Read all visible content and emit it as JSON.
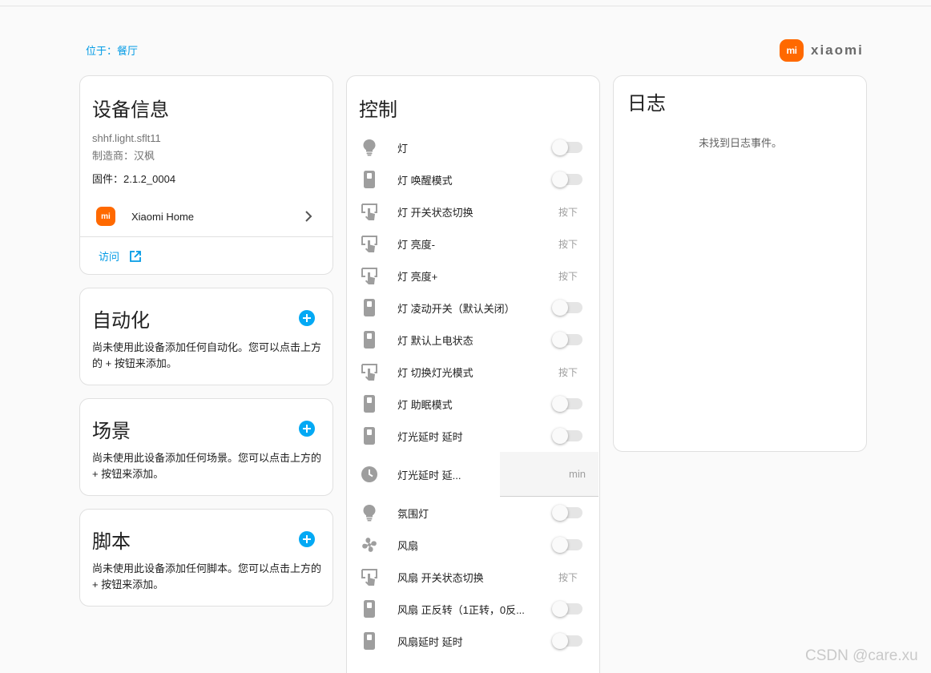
{
  "location": "位于：餐厅",
  "brand": {
    "logo_text": "mi",
    "name": "xiaomi",
    "color": "#ff6900"
  },
  "device_info": {
    "title": "设备信息",
    "model": "shhf.light.sflt11",
    "manufacturer": "制造商：汉枫",
    "firmware": "固件：2.1.2_0004",
    "integration": {
      "logo_text": "mi",
      "name": "Xiaomi Home",
      "icon": "chevron-right-icon"
    },
    "visit_label": "访问",
    "visit_icon": "external-link-icon"
  },
  "automation": {
    "title": "自动化",
    "description": "尚未使用此设备添加任何自动化。您可以点击上方的 + 按钮来添加。"
  },
  "scene": {
    "title": "场景",
    "description": "尚未使用此设备添加任何场景。您可以点击上方的 + 按钮来添加。"
  },
  "script": {
    "title": "脚本",
    "description": "尚未使用此设备添加任何脚本。您可以点击上方的 + 按钮来添加。"
  },
  "controls": {
    "title": "控制",
    "press_label": "按下",
    "items": [
      {
        "label": "灯",
        "icon": "lightbulb-icon",
        "type": "toggle"
      },
      {
        "label": "灯 唤醒模式",
        "icon": "switch-icon",
        "type": "toggle"
      },
      {
        "label": "灯 开关状态切换",
        "icon": "button-press-icon",
        "type": "press"
      },
      {
        "label": "灯 亮度-",
        "icon": "button-press-icon",
        "type": "press"
      },
      {
        "label": "灯 亮度+",
        "icon": "button-press-icon",
        "type": "press"
      },
      {
        "label": "灯 凌动开关（默认关闭）",
        "icon": "switch-icon",
        "type": "toggle"
      },
      {
        "label": "灯 默认上电状态",
        "icon": "switch-icon",
        "type": "toggle"
      },
      {
        "label": "灯 切换灯光模式",
        "icon": "button-press-icon",
        "type": "press"
      },
      {
        "label": "灯 助眠模式",
        "icon": "switch-icon",
        "type": "toggle"
      },
      {
        "label": "灯光延时 延时",
        "icon": "switch-icon",
        "type": "toggle"
      },
      {
        "label": "灯光延时 延...",
        "icon": "clock-icon",
        "type": "number",
        "unit": "min"
      },
      {
        "label": "氛围灯",
        "icon": "lightbulb-icon",
        "type": "toggle"
      },
      {
        "label": "风扇",
        "icon": "fan-icon",
        "type": "toggle"
      },
      {
        "label": "风扇 开关状态切换",
        "icon": "button-press-icon",
        "type": "press"
      },
      {
        "label": "风扇 正反转（1正转，0反...",
        "icon": "switch-icon",
        "type": "toggle"
      },
      {
        "label": "风扇延时 延时",
        "icon": "switch-icon",
        "type": "toggle"
      }
    ]
  },
  "logbook": {
    "title": "日志",
    "empty_text": "未找到日志事件。"
  },
  "watermark": "CSDN @care.xu"
}
